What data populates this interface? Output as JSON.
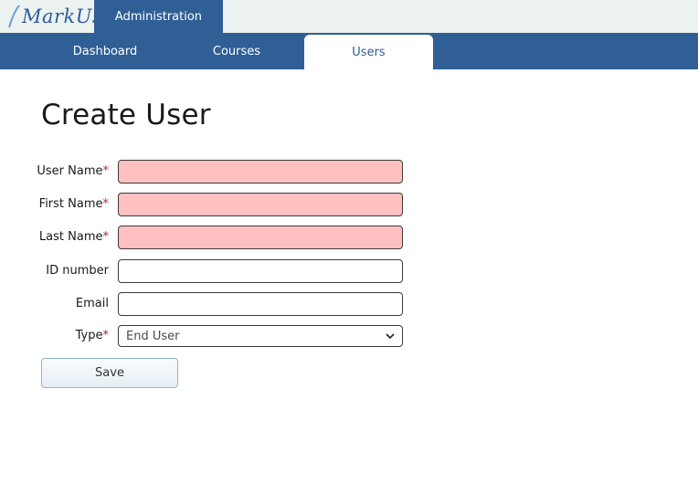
{
  "header": {
    "logo_text": "MarkUs",
    "admin_tab": "Administration"
  },
  "nav": {
    "items": [
      {
        "label": "Dashboard",
        "active": false
      },
      {
        "label": "Courses",
        "active": false
      },
      {
        "label": "Users",
        "active": true
      }
    ]
  },
  "page": {
    "title": "Create User"
  },
  "form": {
    "fields": [
      {
        "label": "User Name",
        "required": true,
        "value": ""
      },
      {
        "label": "First Name",
        "required": true,
        "value": ""
      },
      {
        "label": "Last Name",
        "required": true,
        "value": ""
      },
      {
        "label": "ID number",
        "required": false,
        "value": ""
      },
      {
        "label": "Email",
        "required": false,
        "value": ""
      }
    ],
    "type": {
      "label": "Type",
      "required": true,
      "selected": "End User"
    },
    "required_marker": "*",
    "save_label": "Save"
  },
  "colors": {
    "brand": "#2f5f95",
    "required_bg": "#ffc0c0",
    "required_marker": "#b3262b"
  }
}
